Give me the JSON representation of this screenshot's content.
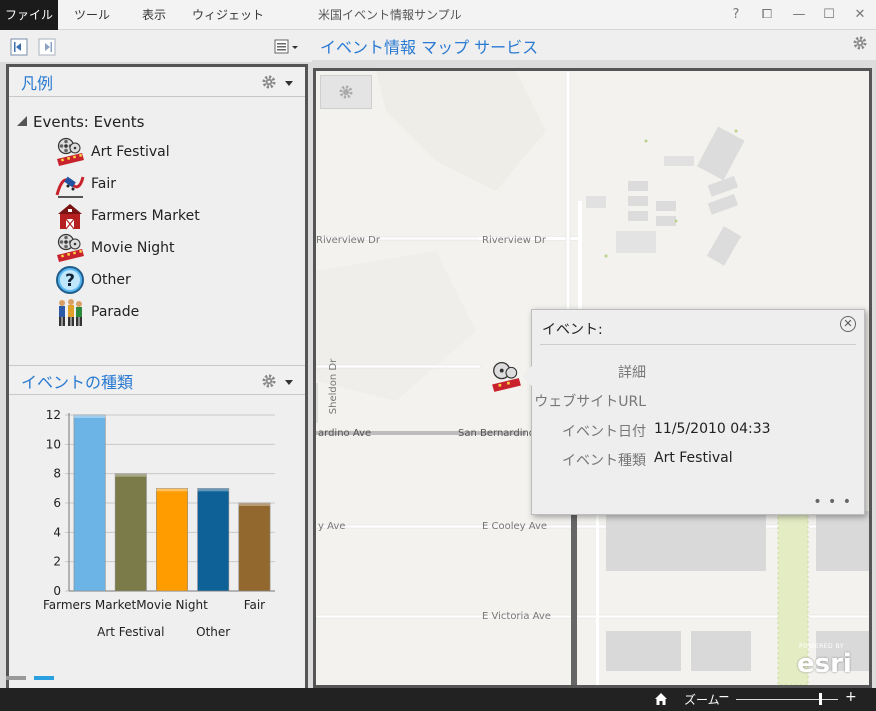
{
  "ribbon": {
    "tabs": [
      "ファイル",
      "ツール",
      "表示",
      "ウィジェット"
    ],
    "active_tab": 0,
    "app_title": "米国イベント情報サンプル",
    "window_buttons": [
      "?",
      "⧠",
      "—",
      "☐",
      "✕"
    ]
  },
  "legend": {
    "title": "凡例",
    "layer_name": "Events: Events",
    "items": [
      {
        "label": "Art Festival",
        "icon": "film-reel-icon"
      },
      {
        "label": "Fair",
        "icon": "roller-coaster-icon"
      },
      {
        "label": "Farmers Market",
        "icon": "barn-icon"
      },
      {
        "label": "Movie Night",
        "icon": "film-reel-icon"
      },
      {
        "label": "Other",
        "icon": "question-mark-icon"
      },
      {
        "label": "Parade",
        "icon": "parade-people-icon"
      }
    ]
  },
  "chart_panel": {
    "title": "イベントの種類"
  },
  "chart_data": {
    "type": "bar",
    "categories": [
      "Farmers Market",
      "Art Festival",
      "Movie Night",
      "Other",
      "Fair"
    ],
    "values": [
      12,
      8,
      7,
      7,
      6
    ],
    "colors": [
      "#6cb4e6",
      "#7b7b4a",
      "#ff9d00",
      "#0e6197",
      "#93682e"
    ],
    "xlabel": "",
    "ylabel": "",
    "ylim": [
      0,
      12
    ],
    "yticks": [
      0,
      2,
      4,
      6,
      8,
      10,
      12
    ],
    "grid": true
  },
  "map": {
    "title": "イベント情報 マップ サービス",
    "roads": [
      "Riverview Dr",
      "Riverview Dr",
      "Sheldon Dr",
      "ardino Ave",
      "San Bernardino",
      "y Ave",
      "E Cooley Ave",
      "E Victoria Ave"
    ]
  },
  "popup": {
    "title": "イベント:",
    "close_symbol": "✕",
    "more_symbol": "• • •",
    "rows": [
      {
        "key": "詳細",
        "value": ""
      },
      {
        "key": "ウェブサイトURL",
        "value": ""
      },
      {
        "key": "イベント日付",
        "value": "11/5/2010 04:33"
      },
      {
        "key": "イベント種類",
        "value": "Art Festival"
      }
    ]
  },
  "branding": {
    "powered_by": "POWERED BY",
    "logo_text": "esri"
  },
  "statusbar": {
    "zoom_label": "ズーム",
    "zoom_minus": "−",
    "zoom_plus": "+",
    "zoom_level": 0.82
  },
  "colors": {
    "accent": "#2a7ad2",
    "frame": "#555555",
    "statusbar": "#222222"
  }
}
